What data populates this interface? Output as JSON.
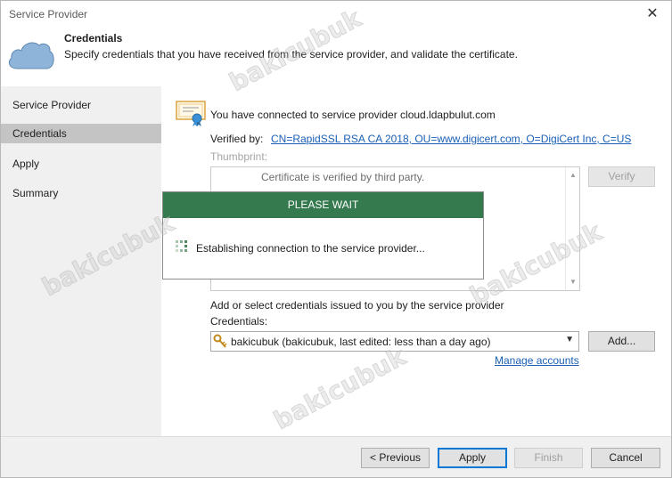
{
  "window": {
    "title": "Service Provider",
    "close_glyph": "✕"
  },
  "header": {
    "title": "Credentials",
    "subtitle": "Specify credentials that you have received from the service provider, and validate the certificate.",
    "icon": "cloud-icon"
  },
  "sidebar": {
    "items": [
      {
        "label": "Service Provider",
        "active": false
      },
      {
        "label": "Credentials",
        "active": true
      },
      {
        "label": "Apply",
        "active": false
      },
      {
        "label": "Summary",
        "active": false
      }
    ]
  },
  "main": {
    "connected_text": "You have connected to service provider cloud.ldapbulut.com",
    "verified_label": "Verified by:",
    "verified_link": "CN=RapidSSL RSA CA 2018, OU=www.digicert.com, O=DigiCert Inc, C=US",
    "thumbprint_label": "Thumbprint:",
    "cert_status": "Certificate is verified by third party.",
    "verify_button": "Verify",
    "add_credentials_text": "Add or select credentials issued to you by the service provider",
    "credentials_label": "Credentials:",
    "credentials_value": "bakicubuk (bakicubuk, last edited: less than a day ago)",
    "add_button": "Add...",
    "manage_accounts": "Manage accounts"
  },
  "wait_dialog": {
    "title": "PLEASE WAIT",
    "message": "Establishing connection to the service provider..."
  },
  "footer": {
    "previous": "< Previous",
    "apply": "Apply",
    "finish": "Finish",
    "cancel": "Cancel"
  },
  "colors": {
    "wait_bar": "#357a4f",
    "link": "#1a5fb4",
    "sidebar_bg": "#f0f0f0",
    "sidebar_active": "#c4c4c4"
  },
  "watermark": "bakicubuk"
}
